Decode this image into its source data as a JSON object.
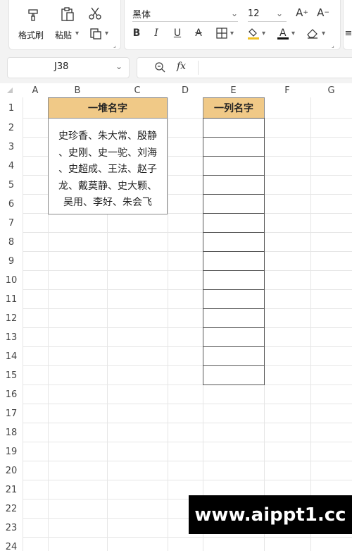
{
  "ribbon": {
    "format_painter": "格式刷",
    "paste": "粘贴",
    "font_name": "黑体",
    "font_size": "12",
    "font_buttons": {
      "bold": "B",
      "italic": "I",
      "underline": "U",
      "strikethrough": "A",
      "grow": "A+",
      "shrink": "A-"
    }
  },
  "formula_bar": {
    "name_box": "J38",
    "fx": "fx",
    "formula": ""
  },
  "columns": [
    "A",
    "B",
    "C",
    "D",
    "E",
    "F",
    "G"
  ],
  "rows": [
    "1",
    "2",
    "3",
    "4",
    "5",
    "6",
    "7",
    "8",
    "9",
    "10",
    "11",
    "12",
    "13",
    "14",
    "15",
    "16",
    "17",
    "18",
    "19",
    "20",
    "21",
    "22",
    "23",
    "24"
  ],
  "cells": {
    "b1": "一堆名字",
    "b_names": [
      "史珍香、朱大常、殷静",
      "、史刚、史一驼、刘海",
      "、史超成、王法、赵子",
      "龙、戴莫静、史大颗、",
      "吴用、李好、朱会飞"
    ],
    "e1": "一列名字"
  },
  "watermark": "www.aippt1.cc"
}
